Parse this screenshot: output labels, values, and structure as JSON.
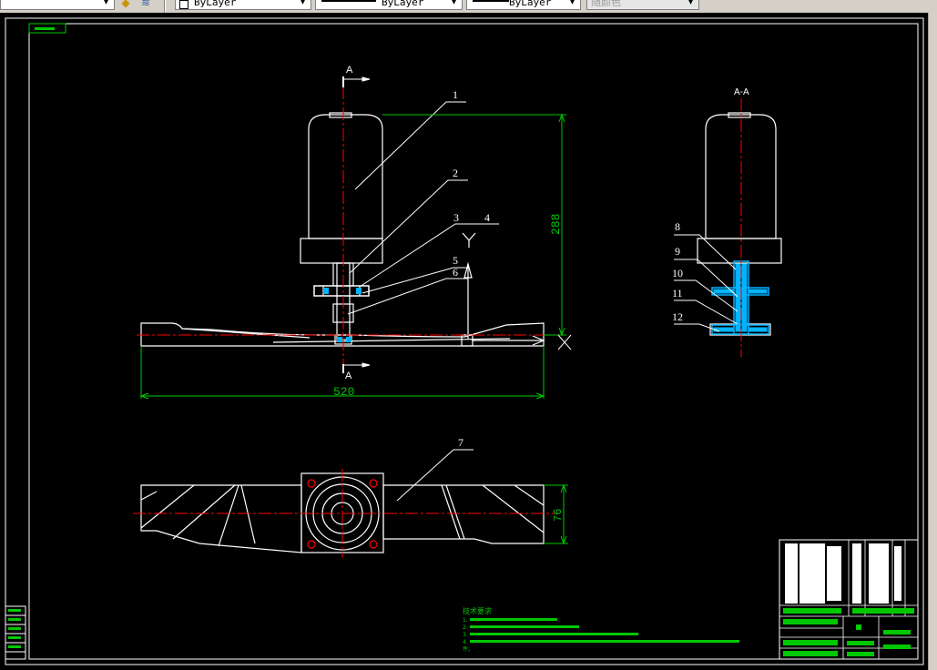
{
  "toolbar": {
    "layer_combo": "",
    "color_combo": "ByLayer",
    "linetype_combo": "ByLayer",
    "lineweight_combo": "ByLayer",
    "plotstyle_combo": "随颜色"
  },
  "drawing": {
    "corner_tag": "",
    "section_marker": "A",
    "section_view_label": "A-A",
    "part_numbers": [
      "1",
      "2",
      "3",
      "4",
      "5",
      "6",
      "7",
      "8",
      "9",
      "10",
      "11",
      "12"
    ],
    "dim_height": "288",
    "dim_width": "520",
    "dim_blade": "76",
    "notes_title": "技术要求",
    "notes_lines": [
      "1.",
      "2.",
      "3.",
      "4.",
      "件。"
    ]
  },
  "colors": {
    "background": "#000000",
    "outline": "#ffffff",
    "centerline": "#ff0000",
    "dimension": "#00c800",
    "hatch": "#00b4ff"
  }
}
